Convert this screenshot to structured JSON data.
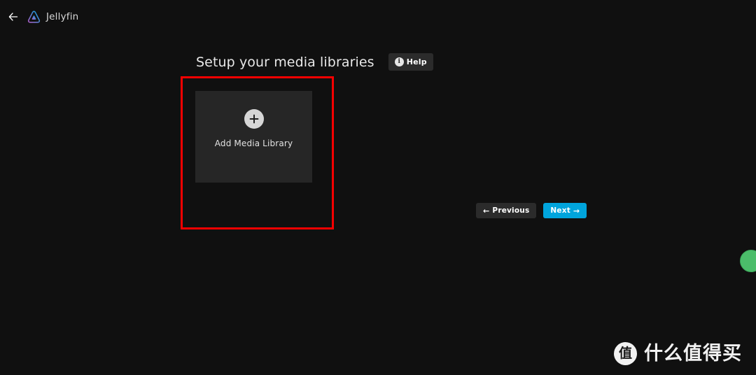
{
  "topbar": {
    "back_icon": "arrow-left-icon",
    "brand_name": "Jellyfin",
    "brand_logo_icon": "jellyfin-logo-icon"
  },
  "main": {
    "page_title": "Setup your media libraries",
    "help_button": {
      "label": "Help",
      "icon": "info-circle-icon"
    },
    "library_card": {
      "add_icon": "plus-circle-icon",
      "label": "Add Media Library"
    },
    "navigation": {
      "previous_label": "Previous",
      "previous_arrow": "←",
      "next_label": "Next",
      "next_arrow": "→"
    }
  },
  "annotation": {
    "type": "highlight-rectangle",
    "color": "#f60000"
  },
  "float_badge": {
    "icon": "green-circle-badge-icon",
    "color": "#4bbd6a"
  },
  "watermark": {
    "logo_char": "值",
    "text": "什么值得买"
  },
  "colors": {
    "background": "#101010",
    "card": "#262626",
    "accent": "#00a4dc",
    "button_dark": "#2b2b2b",
    "annotation_red": "#f60000"
  }
}
